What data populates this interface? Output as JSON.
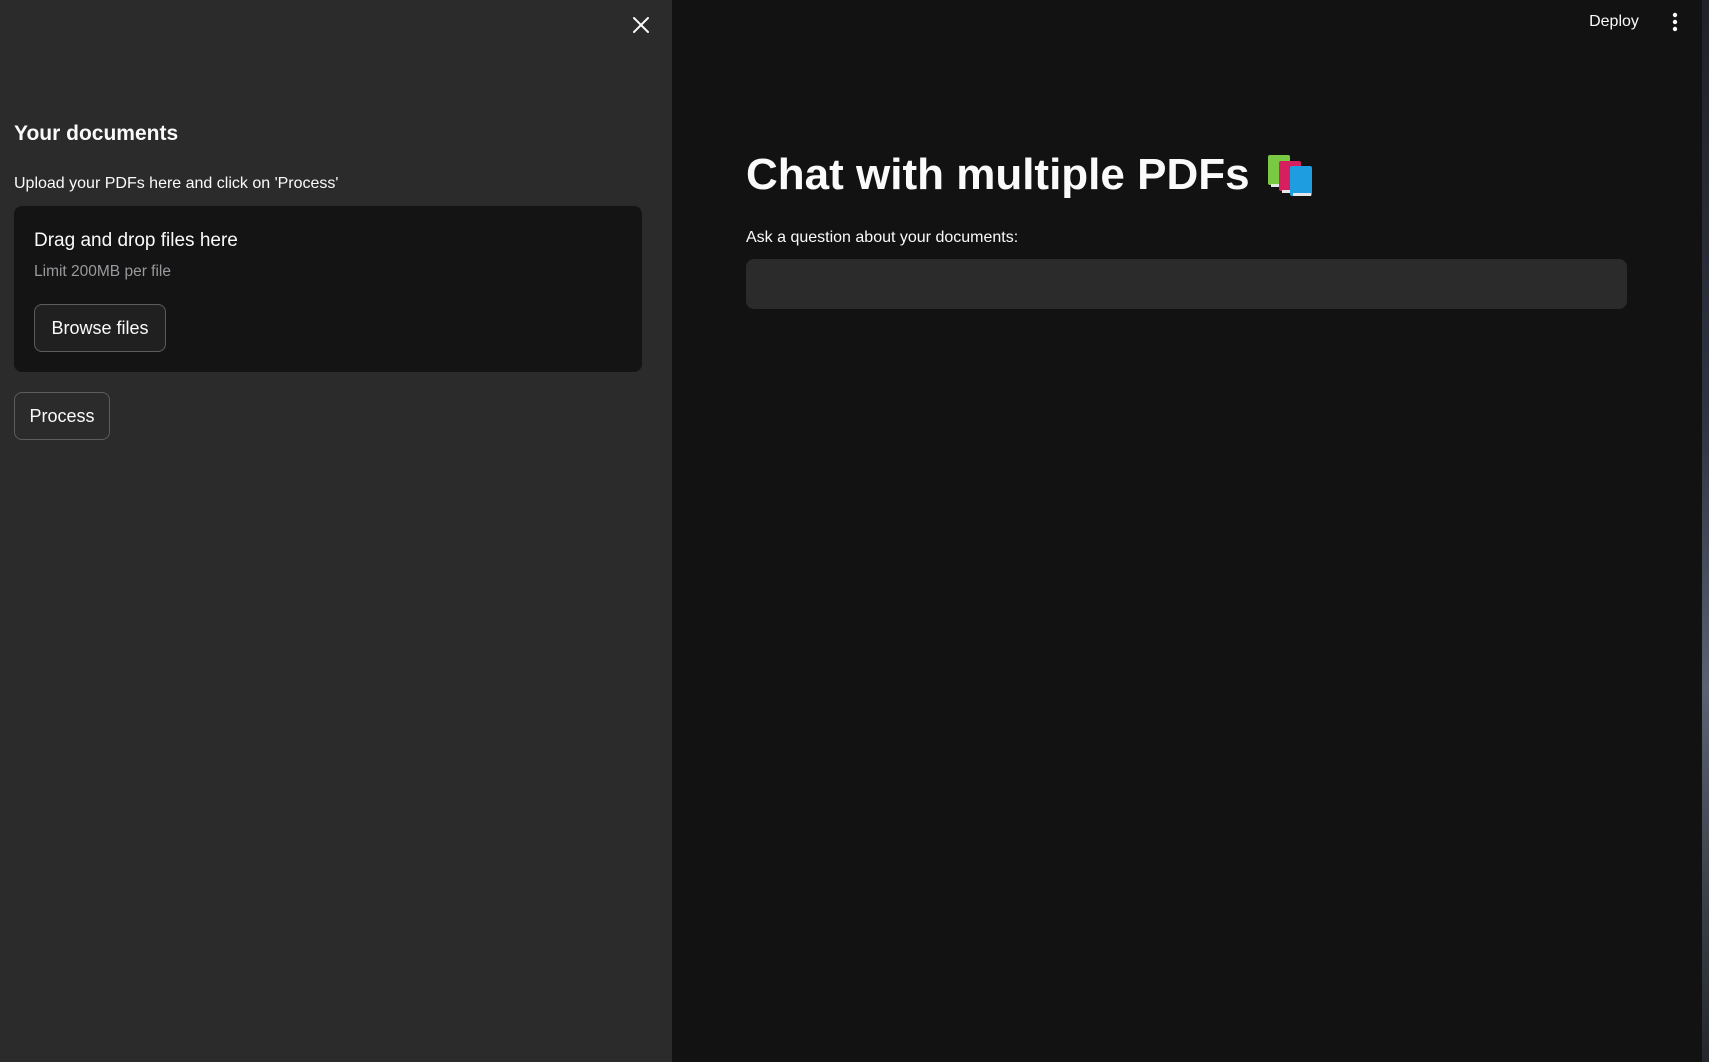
{
  "sidebar": {
    "heading": "Your documents",
    "uploader": {
      "label": "Upload your PDFs here and click on 'Process'",
      "dropzone_title": "Drag and drop files here",
      "dropzone_limit": "Limit 200MB per file",
      "browse_label": "Browse files"
    },
    "process_label": "Process",
    "close_icon": "close-icon"
  },
  "header": {
    "deploy_label": "Deploy",
    "menu_icon": "more-vertical-icon"
  },
  "main": {
    "title": "Chat with multiple PDFs",
    "title_icon": "books-icon",
    "question_label": "Ask a question about your documents:",
    "question_value": ""
  },
  "colors": {
    "sidebar_bg": "#2b2b2c",
    "main_bg": "#121212",
    "dropzone_bg": "#141414",
    "input_bg": "#2b2b2c",
    "text": "#fafafa",
    "muted_text": "#9a9a9e"
  }
}
